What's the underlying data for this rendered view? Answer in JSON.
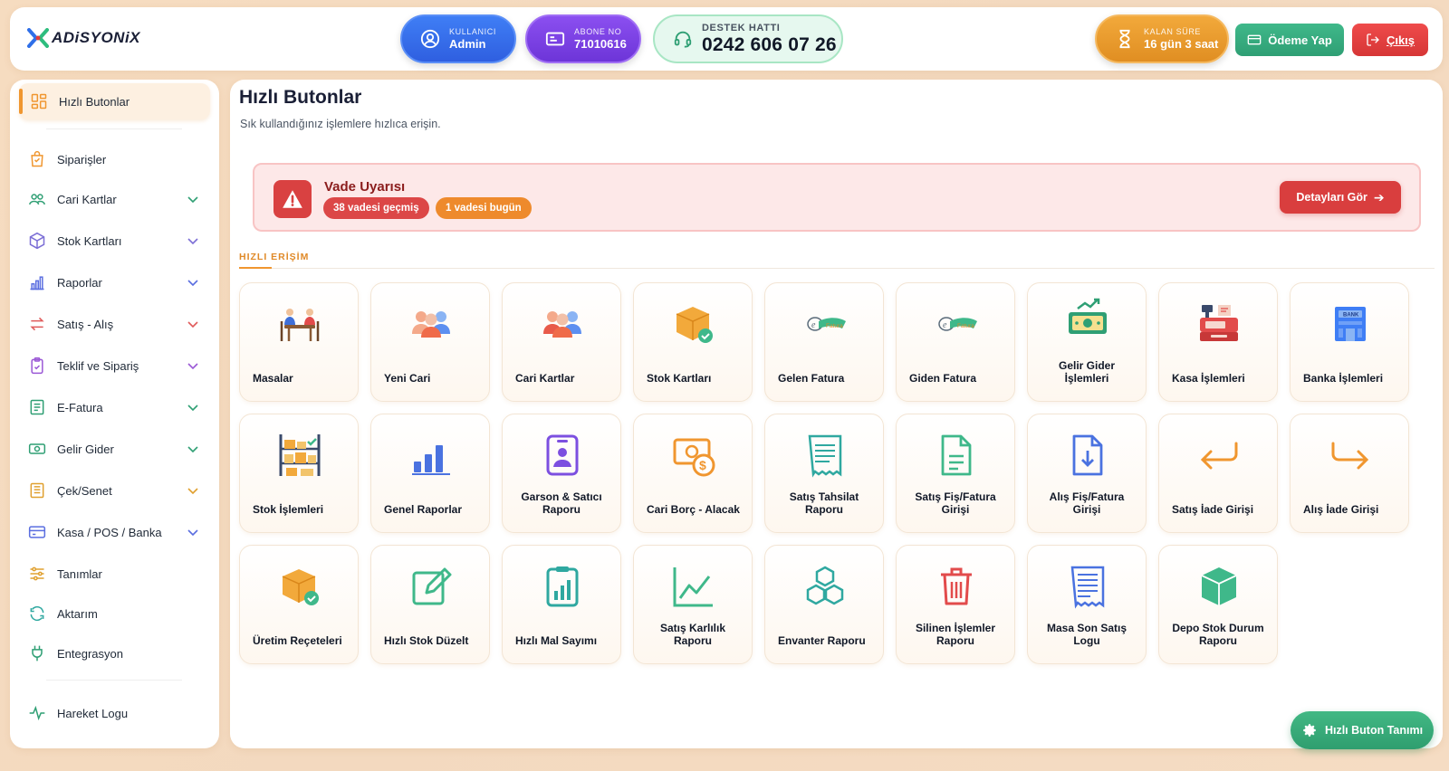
{
  "header": {
    "logo_text": "ADiSYONiX",
    "user": {
      "label": "KULLANICI",
      "value": "Admin"
    },
    "abone": {
      "label": "ABONE NO",
      "value": "71010616"
    },
    "support": {
      "label": "DESTEK HATTI",
      "value": "0242 606 07 26"
    },
    "time": {
      "label": "KALAN SÜRE",
      "value": "16 gün 3 saat"
    },
    "pay_label": "Ödeme Yap",
    "exit_label": "Çıkış"
  },
  "sidebar": {
    "active": "Hızlı Butonlar",
    "items": [
      {
        "label": "Siparişler",
        "chevron": false
      },
      {
        "label": "Cari Kartlar",
        "chevron": true
      },
      {
        "label": "Stok Kartları",
        "chevron": true
      },
      {
        "label": "Raporlar",
        "chevron": true
      },
      {
        "label": "Satış - Alış",
        "chevron": true
      },
      {
        "label": "Teklif ve Sipariş",
        "chevron": true
      },
      {
        "label": "E-Fatura",
        "chevron": true
      },
      {
        "label": "Gelir Gider",
        "chevron": true
      },
      {
        "label": "Çek/Senet",
        "chevron": true
      },
      {
        "label": "Kasa / POS / Banka",
        "chevron": true
      },
      {
        "label": "Tanımlar",
        "chevron": false
      },
      {
        "label": "Aktarım",
        "chevron": false
      },
      {
        "label": "Entegrasyon",
        "chevron": false
      }
    ],
    "bottom": "Hareket Logu"
  },
  "main": {
    "title": "Hızlı Butonlar",
    "subtitle": "Sık kullandığınız işlemlere hızlıca erişin.",
    "alert": {
      "title": "Vade Uyarısı",
      "badge_overdue": "38 vadesi geçmiş",
      "badge_today": "1 vadesi bugün",
      "button": "Detayları Gör"
    },
    "section_label": "HIZLI ERİŞİM",
    "tiles": [
      {
        "label": "Masalar"
      },
      {
        "label": "Yeni Cari"
      },
      {
        "label": "Cari Kartlar"
      },
      {
        "label": "Stok Kartları"
      },
      {
        "label": "Gelen Fatura"
      },
      {
        "label": "Giden Fatura"
      },
      {
        "label": "Gelir Gider İşlemleri"
      },
      {
        "label": "Kasa İşlemleri"
      },
      {
        "label": "Banka İşlemleri"
      },
      {
        "label": "Stok İşlemleri"
      },
      {
        "label": "Genel Raporlar"
      },
      {
        "label": "Garson & Satıcı Raporu"
      },
      {
        "label": "Cari Borç - Alacak"
      },
      {
        "label": "Satış Tahsilat Raporu"
      },
      {
        "label": "Satış Fiş/Fatura Girişi"
      },
      {
        "label": "Alış Fiş/Fatura Girişi"
      },
      {
        "label": "Satış İade Girişi"
      },
      {
        "label": "Alış İade Girişi"
      },
      {
        "label": "Üretim Reçeteleri"
      },
      {
        "label": "Hızlı Stok Düzelt"
      },
      {
        "label": "Hızlı Mal Sayımı"
      },
      {
        "label": "Satış Karlılık Raporu"
      },
      {
        "label": "Envanter Raporu"
      },
      {
        "label": "Silinen İşlemler Raporu"
      },
      {
        "label": "Masa Son Satış Logu"
      },
      {
        "label": "Depo Stok Durum Raporu"
      }
    ],
    "fab_label": "Hızlı Buton Tanımı"
  },
  "colors": {
    "accent": "#f0962f",
    "danger": "#d93e3e",
    "success": "#2f9f74",
    "blue": "#2f5fe0",
    "purple": "#6d35d8"
  }
}
